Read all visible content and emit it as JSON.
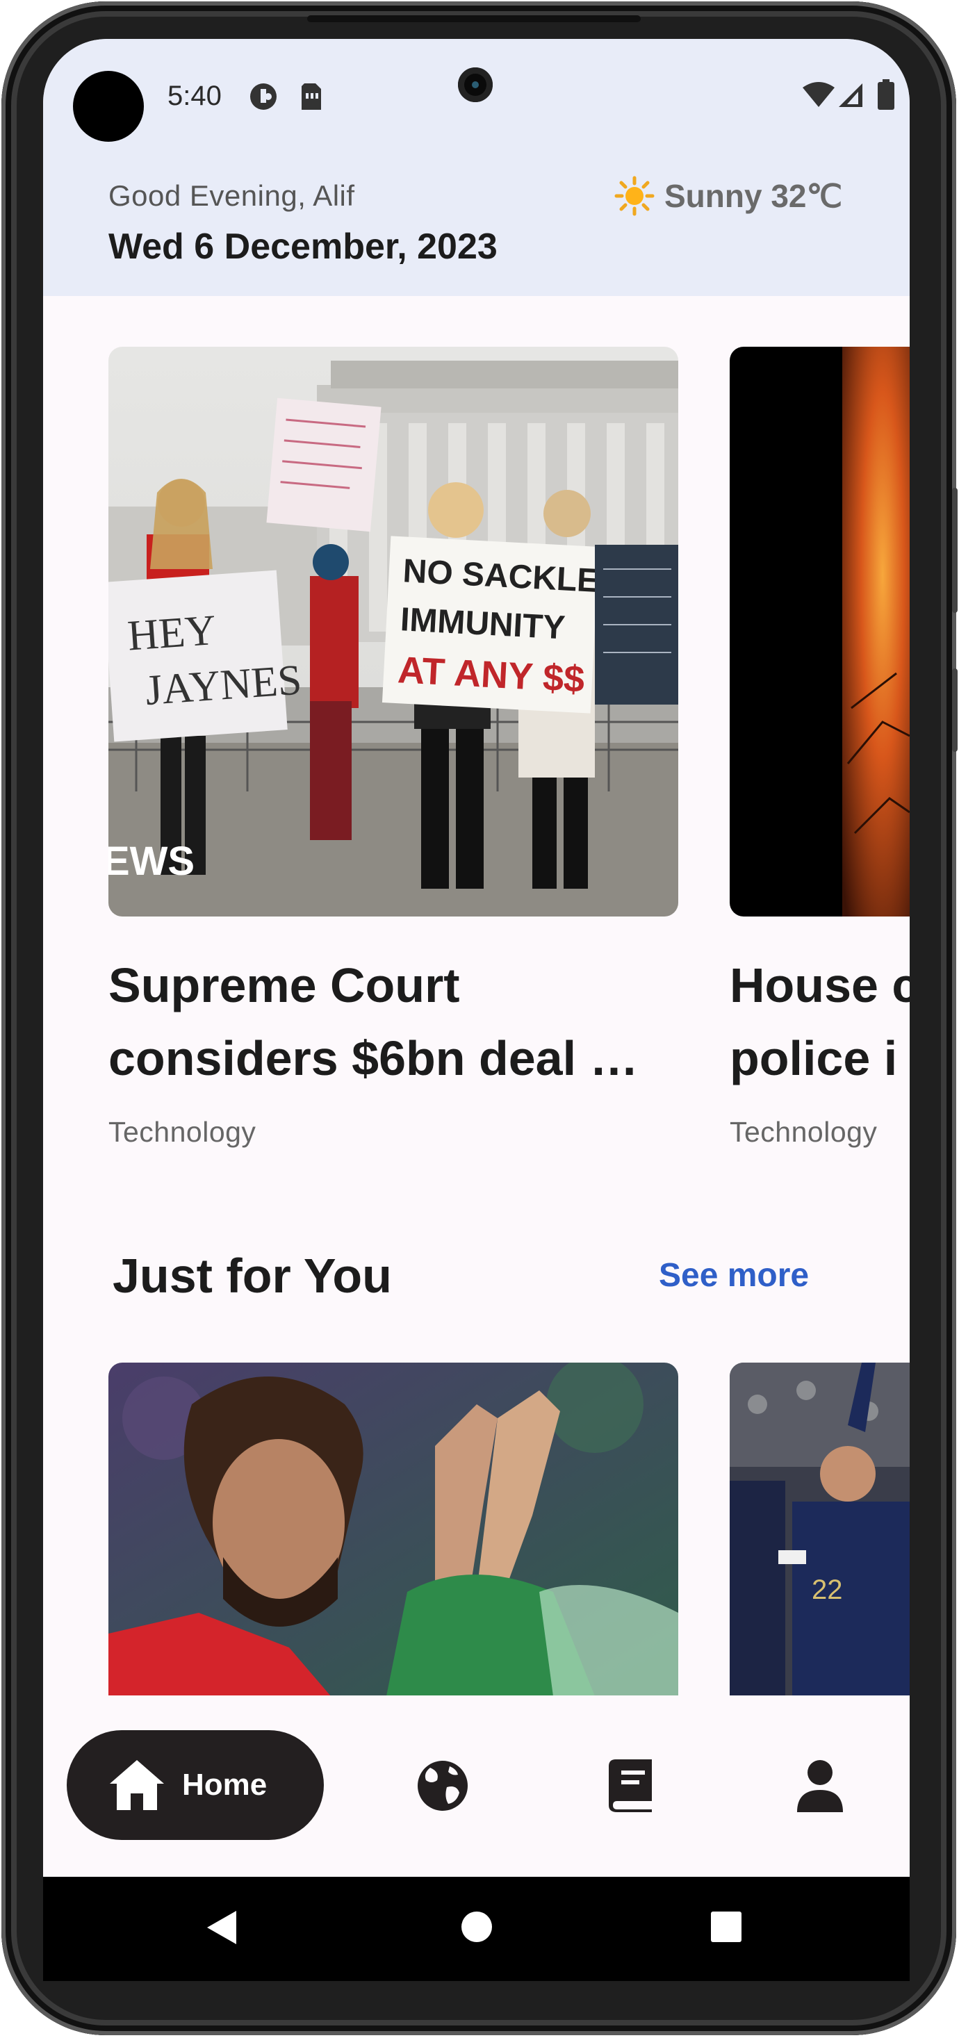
{
  "status_bar": {
    "time": "5:40"
  },
  "header": {
    "greeting": "Good Evening, Alif",
    "date": "Wed 6 December, 2023",
    "weather": "Sunny 32℃",
    "weather_icon": "sun-icon"
  },
  "headlines": [
    {
      "title_line1": "Supreme Court",
      "title_line2": "considers $6bn deal …",
      "category": "Technology",
      "image_caption": "EWS",
      "sign_text": [
        "NO SACKLER",
        "IMMUNITY",
        "AT ANY $$"
      ]
    },
    {
      "title_line1": "House c",
      "title_line2": "police i",
      "category": "Technology"
    }
  ],
  "just_for_you": {
    "title": "Just for You",
    "see_more": "See more"
  },
  "bottom_nav": {
    "home_label": "Home",
    "items": [
      "home-icon",
      "globe-icon",
      "book-icon",
      "profile-icon"
    ],
    "active_color": "#231f20"
  },
  "colors": {
    "header_bg": "#e8ecf8",
    "accent": "#2f5fc8",
    "screen_bg": "#fdf9fc"
  }
}
